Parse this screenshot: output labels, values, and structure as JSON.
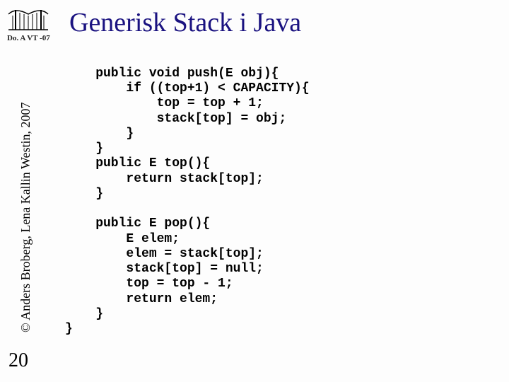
{
  "header": {
    "course_tag": "Do. A VT -07",
    "title": "Generisk Stack i Java"
  },
  "sidebar": {
    "copyright": "© Anders Broberg, Lena Kallin Westin, 2007"
  },
  "footer": {
    "page_number": "20"
  },
  "code": {
    "block": "    public void push(E obj){\n        if ((top+1) < CAPACITY){\n            top = top + 1;\n            stack[top] = obj;\n        }\n    }\n    public E top(){\n        return stack[top];\n    }\n\n    public E pop(){\n        E elem;\n        elem = stack[top];\n        stack[top] = null;\n        top = top - 1;\n        return elem;\n    }\n}"
  }
}
